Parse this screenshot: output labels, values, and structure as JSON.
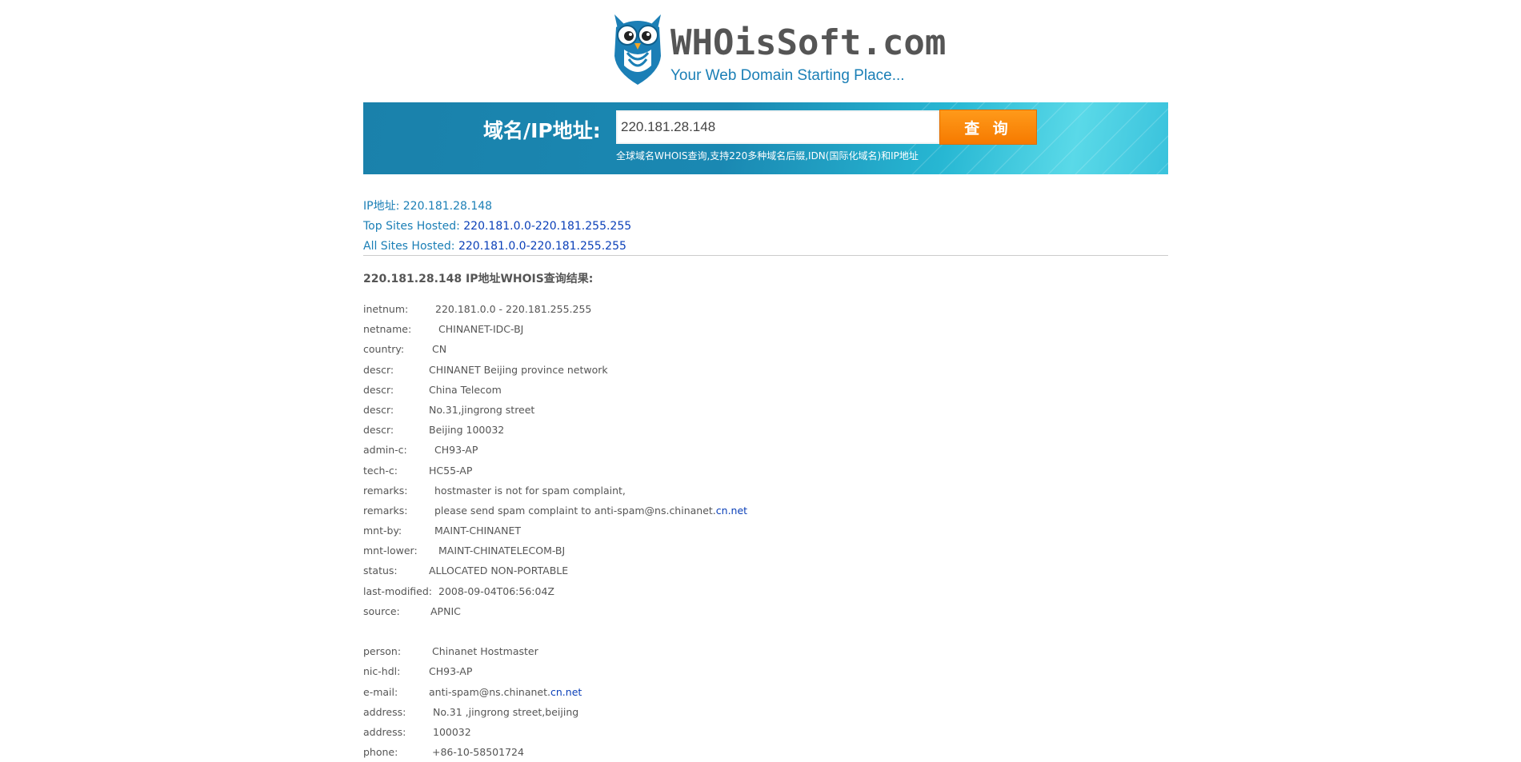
{
  "logo": {
    "name": "WHOisSoft.com",
    "tagline": "Your Web Domain Starting Place..."
  },
  "search": {
    "label": "域名/IP地址:",
    "value": "220.181.28.148",
    "button_label": "查 询",
    "hint": "全球域名WHOIS查询,支持220多种域名后缀,IDN(国际化域名)和IP地址"
  },
  "ip_info": {
    "ip_label": "IP地址:",
    "ip_value": "220.181.28.148",
    "top_sites_label": "Top Sites Hosted:",
    "top_sites_value": "220.181.0.0-220.181.255.255",
    "all_sites_label": "All Sites Hosted:",
    "all_sites_value": "220.181.0.0-220.181.255.255"
  },
  "result_heading": "220.181.28.148 IP地址WHOIS查询结果:",
  "whois": [
    {
      "key": "inetnum:",
      "value": "220.181.0.0 - 220.181.255.255"
    },
    {
      "key": "netname:",
      "value": "CHINANET-IDC-BJ"
    },
    {
      "key": "country:",
      "value": "CN"
    },
    {
      "key": "descr:",
      "value": "CHINANET Beijing province network"
    },
    {
      "key": "descr:",
      "value": "China Telecom"
    },
    {
      "key": "descr:",
      "value": "No.31,jingrong street"
    },
    {
      "key": "descr:",
      "value": "Beijing 100032"
    },
    {
      "key": "admin-c:",
      "value": "CH93-AP"
    },
    {
      "key": "tech-c:",
      "value": "HC55-AP"
    },
    {
      "key": "remarks:",
      "value": "hostmaster is not for spam complaint,"
    },
    {
      "key": "remarks:",
      "value": "please send spam complaint to anti-spam@ns.chinanet.",
      "link": "cn.net"
    },
    {
      "key": "mnt-by:",
      "value": "MAINT-CHINANET"
    },
    {
      "key": "mnt-lower:",
      "value": "MAINT-CHINATELECOM-BJ"
    },
    {
      "key": "status:",
      "value": "ALLOCATED NON-PORTABLE"
    },
    {
      "key": "last-modified:",
      "value": "2008-09-04T06:56:04Z"
    },
    {
      "key": "source:",
      "value": "APNIC"
    },
    {
      "key": "person:",
      "value": "Chinanet Hostmaster"
    },
    {
      "key": "nic-hdl:",
      "value": "CH93-AP"
    },
    {
      "key": "e-mail:",
      "value": "anti-spam@ns.chinanet.",
      "link": "cn.net"
    },
    {
      "key": "address:",
      "value": "No.31 ,jingrong street,beijing"
    },
    {
      "key": "address:",
      "value": "100032"
    },
    {
      "key": "phone:",
      "value": "+86-10-58501724"
    }
  ],
  "colors": {
    "brand_blue": "#1b7fb6",
    "link_blue": "#0a3fb8",
    "button_orange": "#f67a00"
  },
  "icons": [
    "owl-logo-icon"
  ]
}
